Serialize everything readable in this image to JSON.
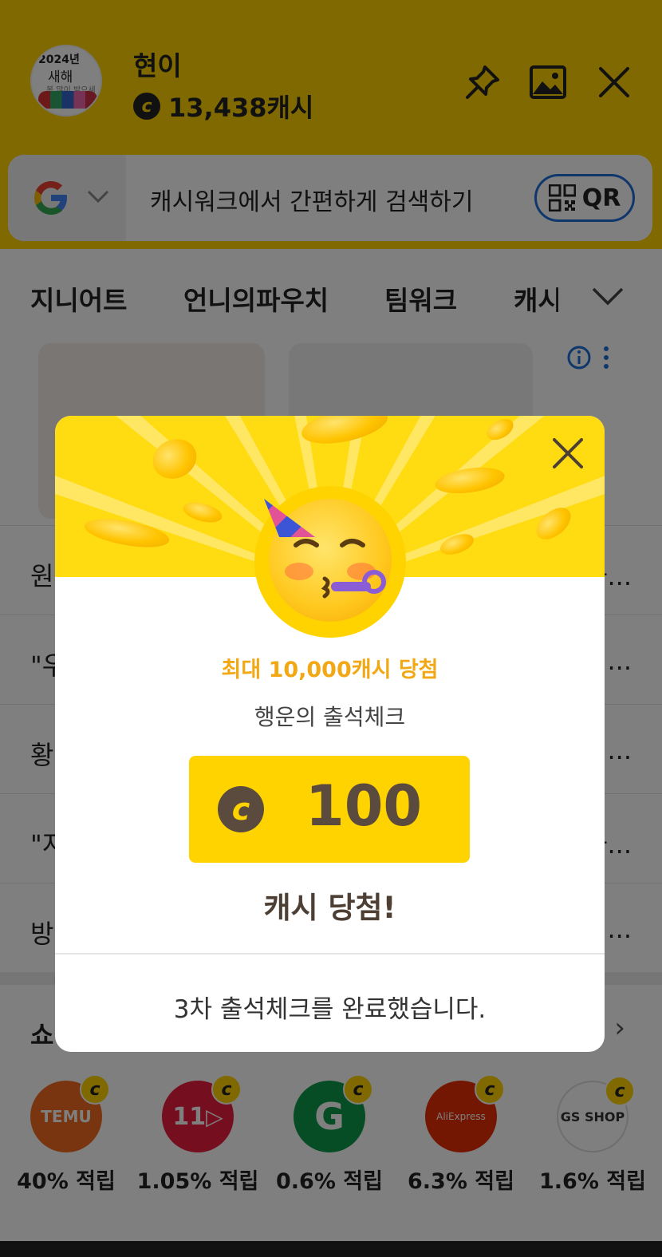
{
  "header": {
    "avatar_text": [
      "2024년",
      "새해",
      "복 많이 받으세요"
    ],
    "user_name": "현이",
    "cash_balance": "13,438캐시",
    "coin_symbol": "c",
    "icons": [
      "pin-icon",
      "image-icon",
      "close-icon"
    ]
  },
  "search": {
    "engine_icon": "google-g-icon",
    "placeholder": "캐시워크에서 간편하게 검색하기",
    "qr_label": "QR"
  },
  "tabs": [
    "지니어트",
    "언니의파우치",
    "팀워크",
    "캐시"
  ],
  "news": [
    {
      "left": "원",
      "right": "하..."
    },
    {
      "left": "\"우",
      "right": "..."
    },
    {
      "left": "황",
      "right": "..."
    },
    {
      "left": "\"지",
      "right": "하..."
    },
    {
      "left": "방",
      "right": "..."
    }
  ],
  "shop": {
    "title": "쇼",
    "items": [
      {
        "logo": "TEMU",
        "rate": "40% 적립",
        "color": "#f26b21"
      },
      {
        "logo": "11",
        "rate": "1.05% 적립",
        "color": "#ea1c3e"
      },
      {
        "logo": "G",
        "rate": "0.6% 적립",
        "color": "#0c9b4a"
      },
      {
        "logo": "AliExpress",
        "rate": "6.3% 적립",
        "color": "#e62e04"
      },
      {
        "logo": "GS SHOP",
        "rate": "1.6% 적립",
        "color": "#ffffff"
      }
    ]
  },
  "modal": {
    "promo": "최대 10,000캐시 당첨",
    "subtitle": "행운의 출석체크",
    "coin_symbol": "c",
    "amount": "100",
    "result": "캐시 당첨!",
    "footer": "3차 출석체크를 완료했습니다."
  },
  "colors": {
    "brand_yellow": "#ffd300",
    "promo_orange": "#f2a814",
    "qr_border": "#1e6fd9",
    "reward_text": "#5a4b3e"
  }
}
